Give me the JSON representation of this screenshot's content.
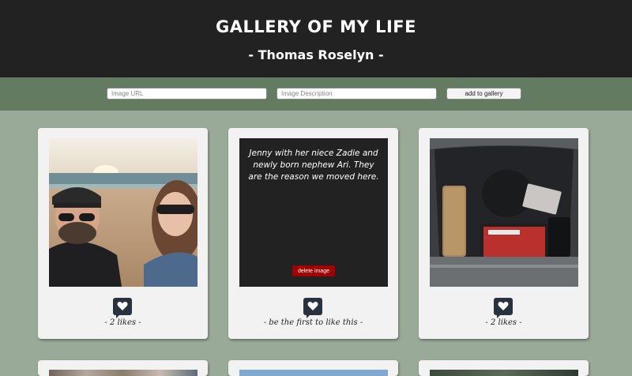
{
  "header": {
    "title": "GALLERY OF MY LIFE",
    "subtitle": "- Thomas Roselyn -"
  },
  "form": {
    "url_placeholder": "Image URL",
    "description_placeholder": "Image Description",
    "add_label": "add to gallery"
  },
  "cards": [
    {
      "likes_text": "- 2 likes -"
    },
    {
      "description": "Jenny with her niece Zadie and newly born nephew Ari. They are the reason we moved here.",
      "delete_label": "delete image",
      "likes_text": "- be the first to like this -"
    },
    {
      "likes_text": "- 2 likes -"
    }
  ],
  "colors": {
    "header_bg": "#222222",
    "form_bar_bg": "#637c61",
    "page_bg": "#9aaa98",
    "like_button": "#29323f",
    "delete_button": "#a00000"
  },
  "icons": {
    "like": "heart-icon"
  }
}
